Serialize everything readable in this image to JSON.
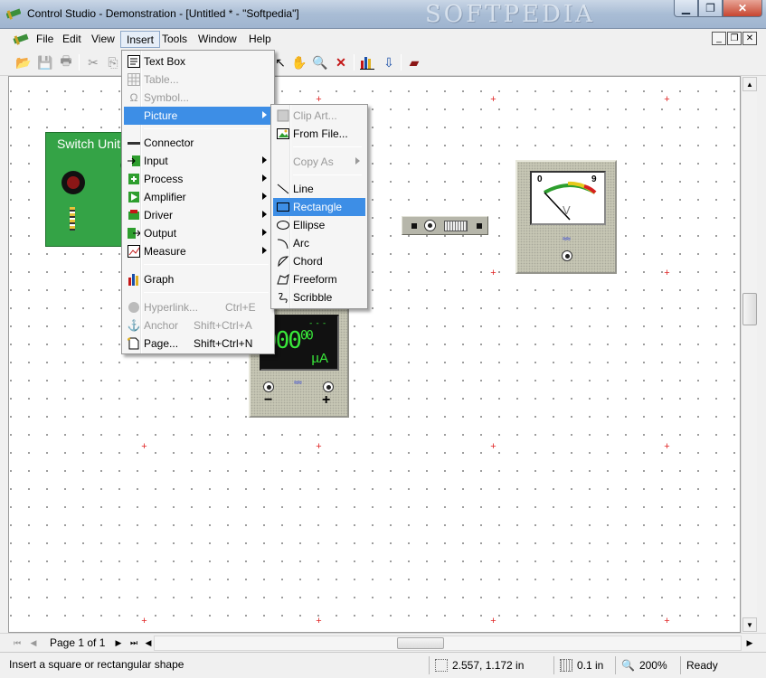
{
  "window": {
    "title": "Control Studio - Demonstration - [Untitled * - \"Softpedia\"]",
    "watermark": "SOFTPEDIA"
  },
  "menubar": {
    "items": [
      "File",
      "Edit",
      "View",
      "Insert",
      "Tools",
      "Window",
      "Help"
    ],
    "active": "Insert"
  },
  "insert_menu": {
    "items": [
      {
        "label": "Text Box",
        "icon": "text-box-icon",
        "enabled": true
      },
      {
        "label": "Table...",
        "icon": "table-icon",
        "enabled": false
      },
      {
        "label": "Symbol...",
        "icon": "symbol-icon",
        "enabled": false
      },
      {
        "label": "Picture",
        "icon": "",
        "enabled": true,
        "submenu": true,
        "highlighted": true
      },
      {
        "label": "Connector",
        "icon": "connector-icon",
        "enabled": true
      },
      {
        "label": "Input",
        "icon": "input-icon",
        "enabled": true,
        "submenu": true
      },
      {
        "label": "Process",
        "icon": "process-icon",
        "enabled": true,
        "submenu": true
      },
      {
        "label": "Amplifier",
        "icon": "amplifier-icon",
        "enabled": true,
        "submenu": true
      },
      {
        "label": "Driver",
        "icon": "driver-icon",
        "enabled": true,
        "submenu": true
      },
      {
        "label": "Output",
        "icon": "output-icon",
        "enabled": true,
        "submenu": true
      },
      {
        "label": "Measure",
        "icon": "measure-icon",
        "enabled": true,
        "submenu": true
      },
      {
        "label": "Graph",
        "icon": "graph-icon",
        "enabled": true
      },
      {
        "label": "Hyperlink...",
        "shortcut": "Ctrl+E",
        "icon": "hyperlink-icon",
        "enabled": false
      },
      {
        "label": "Anchor",
        "shortcut": "Shift+Ctrl+A",
        "icon": "anchor-icon",
        "enabled": false
      },
      {
        "label": "Page...",
        "shortcut": "Shift+Ctrl+N",
        "icon": "page-icon",
        "enabled": true
      }
    ]
  },
  "picture_menu": {
    "items": [
      {
        "label": "Clip Art...",
        "icon": "clip-art-icon",
        "enabled": false
      },
      {
        "label": "From File...",
        "icon": "from-file-icon",
        "enabled": true
      },
      {
        "label": "Copy As",
        "icon": "",
        "enabled": false,
        "submenu": true
      },
      {
        "label": "Line",
        "icon": "line-icon",
        "enabled": true
      },
      {
        "label": "Rectangle",
        "icon": "rectangle-icon",
        "enabled": true,
        "highlighted": true
      },
      {
        "label": "Ellipse",
        "icon": "ellipse-icon",
        "enabled": true
      },
      {
        "label": "Arc",
        "icon": "arc-icon",
        "enabled": true
      },
      {
        "label": "Chord",
        "icon": "chord-icon",
        "enabled": true
      },
      {
        "label": "Freeform",
        "icon": "freeform-icon",
        "enabled": true
      },
      {
        "label": "Scribble",
        "icon": "scribble-icon",
        "enabled": true
      }
    ]
  },
  "toolbar": {
    "buttons": [
      "open-icon",
      "save-icon",
      "print-icon",
      "cut-icon",
      "copy-icon",
      "pointer-icon",
      "hand-icon",
      "zoom-icon",
      "delete-icon",
      "bar-chart-icon",
      "probe-icon",
      "component-icon"
    ]
  },
  "canvas": {
    "switch_unit_title": "Switch Unit",
    "meter": {
      "digits": "000",
      "decimals": "00",
      "dash": "---",
      "unit": "µA",
      "minus": "−",
      "plus": "+",
      "wave": "≈≈"
    },
    "gauge": {
      "min": "0",
      "max": "9",
      "unit": "V",
      "wave": "≈≈"
    }
  },
  "navigation": {
    "page_label": "Page 1 of 1"
  },
  "statusbar": {
    "message": "Insert a square or rectangular shape",
    "coordinates": "2.557, 1.172 in",
    "grid": "0.1 in",
    "zoom": "200%",
    "state": "Ready"
  },
  "colors": {
    "highlight": "#3d8ee6",
    "switch_unit_green": "#34a346",
    "lcd_green": "#39e83a",
    "grid_cross_red": "#e02424"
  }
}
